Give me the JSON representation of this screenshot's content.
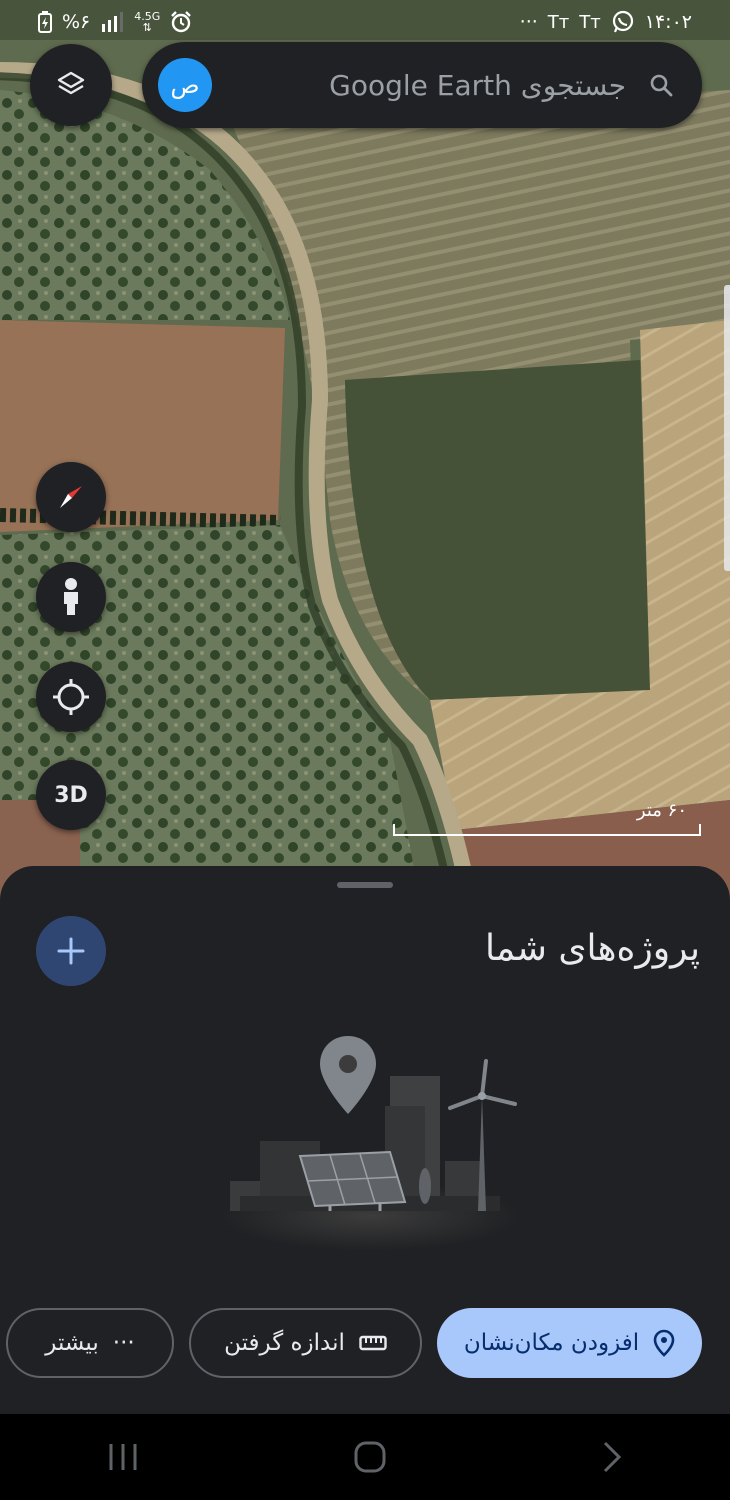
{
  "status_bar": {
    "time": "۱۴:۰۲",
    "battery": "%۶",
    "network": "4.5G",
    "more_dots": "···",
    "font_indicator": "Tт"
  },
  "search": {
    "placeholder": "جستجوی Google Earth",
    "avatar_letter": "ص"
  },
  "map": {
    "scale_label": "۶۰ متر",
    "button_3d": "3D"
  },
  "sheet": {
    "title": "پروژه‌های شما"
  },
  "actions": {
    "more": "بیشتر",
    "more_icon": "···",
    "measure": "اندازه گرفتن",
    "add_placemark": "افزودن مکان‌نشان"
  },
  "colors": {
    "accent": "#a8c7fa",
    "avatar": "#2196f3",
    "sheet_bg": "#202124"
  },
  "icons": {
    "layers": "layers-icon",
    "compass": "compass-icon",
    "pegman": "pegman-icon",
    "location": "my-location-icon",
    "search": "search-icon",
    "plus": "plus-icon",
    "ruler": "ruler-icon",
    "pin": "pin-icon"
  }
}
